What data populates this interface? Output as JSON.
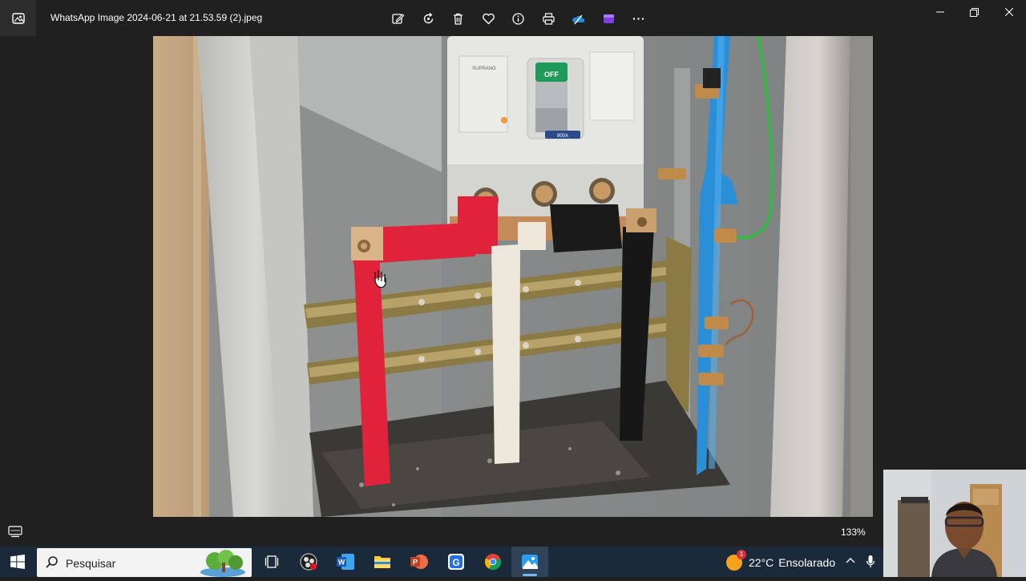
{
  "window": {
    "title": "WhatsApp Image 2024-06-21 at 21.53.59 (2).jpeg",
    "app_icon": "photos-app-icon",
    "toolbar": [
      {
        "name": "edit-icon"
      },
      {
        "name": "rotate-icon"
      },
      {
        "name": "delete-icon"
      },
      {
        "name": "favorite-icon"
      },
      {
        "name": "info-icon"
      },
      {
        "name": "print-icon"
      },
      {
        "name": "onedrive-icon"
      },
      {
        "name": "clipchamp-icon"
      },
      {
        "name": "more-icon"
      }
    ],
    "controls": [
      "minimize-icon",
      "restore-icon",
      "close-icon"
    ]
  },
  "image": {
    "breaker_label": "OFF",
    "breaker_rating": "800A"
  },
  "bottom": {
    "zoom": "133%"
  },
  "taskbar": {
    "search_placeholder": "Pesquisar",
    "apps": [
      "task-view-icon",
      "obs-icon",
      "word-icon",
      "file-explorer-icon",
      "powerpoint-icon",
      "g-app-icon",
      "chrome-icon",
      "photos-app-icon"
    ],
    "weather": {
      "temp": "22°C",
      "condition": "Ensolarado",
      "badge": "1"
    }
  },
  "colors": {
    "bg": "#202020",
    "taskbar": "#1b2a3b",
    "busbar_red": "#e0223a",
    "busbar_blue": "#2a8fd6",
    "breaker_green": "#1f9a5a"
  }
}
